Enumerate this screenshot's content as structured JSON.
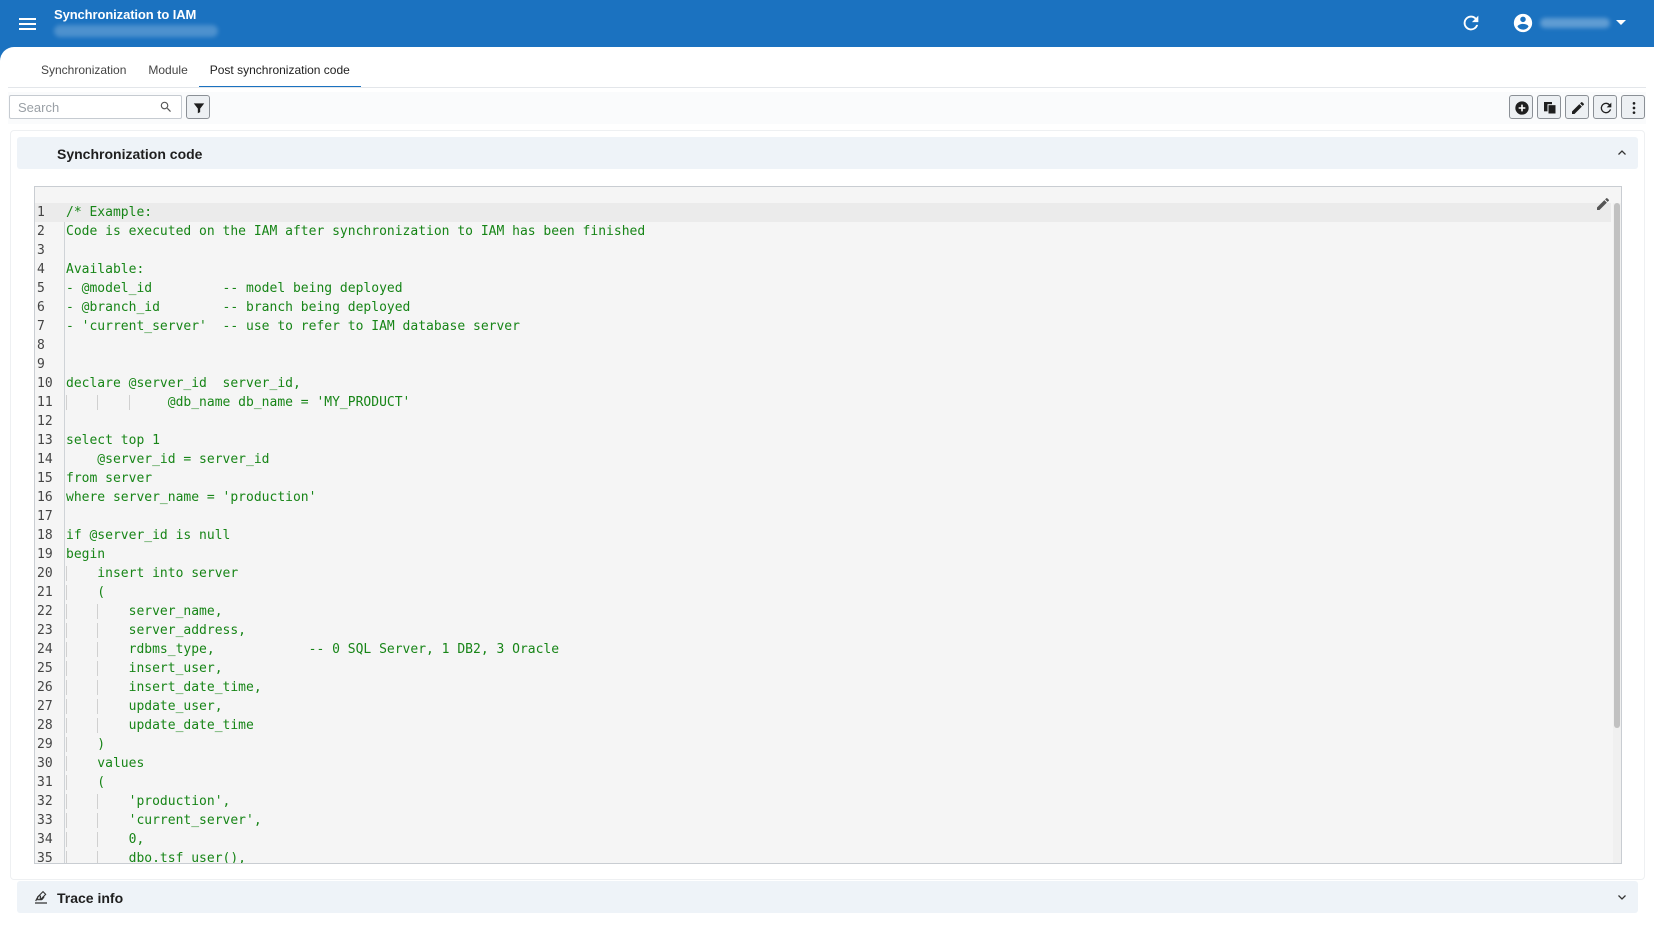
{
  "header": {
    "title": "Synchronization to IAM",
    "menu_icon": "hamburger-menu-icon",
    "refresh_icon": "refresh-icon",
    "account_icon": "account-circle-icon"
  },
  "tabs": [
    {
      "label": "Synchronization"
    },
    {
      "label": "Module"
    },
    {
      "label": "Post synchronization code",
      "active": true
    }
  ],
  "toolbar": {
    "search_placeholder": "Search",
    "right_buttons": [
      "add-icon",
      "copy-icon",
      "edit-icon",
      "refresh-icon",
      "more-icon"
    ]
  },
  "sections": {
    "sync_code": {
      "title": "Synchronization code",
      "expanded": true
    },
    "trace_info": {
      "title": "Trace info",
      "expanded": false
    }
  },
  "editor": {
    "lines": [
      {
        "n": "1",
        "text": "/* Example:",
        "kind": "comment",
        "active": true
      },
      {
        "n": "2",
        "text": "Code is executed on the IAM after synchronization to IAM has been finished",
        "kind": "comment"
      },
      {
        "n": "3",
        "text": "",
        "kind": "comment"
      },
      {
        "n": "4",
        "text": "Available:",
        "kind": "comment"
      },
      {
        "n": "5",
        "text": "- @model_id         -- model being deployed",
        "kind": "comment"
      },
      {
        "n": "6",
        "text": "- @branch_id        -- branch being deployed",
        "kind": "comment"
      },
      {
        "n": "7",
        "text": "- 'current_server'  -- use to refer to IAM database server",
        "kind": "comment"
      },
      {
        "n": "8",
        "text": "",
        "kind": "comment"
      },
      {
        "n": "9",
        "text": "",
        "kind": "comment"
      },
      {
        "n": "10",
        "text": "declare @server_id  server_id,",
        "kind": "comment"
      },
      {
        "n": "11",
        "text": "             @db_name db_name = 'MY_PRODUCT'",
        "kind": "comment",
        "guides": 3
      },
      {
        "n": "12",
        "text": "",
        "kind": "comment"
      },
      {
        "n": "13",
        "text": "select top 1",
        "kind": "comment"
      },
      {
        "n": "14",
        "text": "    @server_id = server_id",
        "kind": "comment"
      },
      {
        "n": "15",
        "text": "from server",
        "kind": "comment"
      },
      {
        "n": "16",
        "text": "where server_name = 'production'",
        "kind": "comment"
      },
      {
        "n": "17",
        "text": "",
        "kind": "comment"
      },
      {
        "n": "18",
        "text": "if @server_id is null",
        "kind": "comment"
      },
      {
        "n": "19",
        "text": "begin",
        "kind": "comment"
      },
      {
        "n": "20",
        "text": "    insert into server",
        "kind": "comment",
        "guides": 1
      },
      {
        "n": "21",
        "text": "    (",
        "kind": "comment",
        "guides": 1
      },
      {
        "n": "22",
        "text": "        server_name,",
        "kind": "comment",
        "guides": 2
      },
      {
        "n": "23",
        "text": "        server_address,",
        "kind": "comment",
        "guides": 2
      },
      {
        "n": "24",
        "text": "        rdbms_type,            -- 0 SQL Server, 1 DB2, 3 Oracle",
        "kind": "comment",
        "guides": 2
      },
      {
        "n": "25",
        "text": "        insert_user,",
        "kind": "comment",
        "guides": 2
      },
      {
        "n": "26",
        "text": "        insert_date_time,",
        "kind": "comment",
        "guides": 2
      },
      {
        "n": "27",
        "text": "        update_user,",
        "kind": "comment",
        "guides": 2
      },
      {
        "n": "28",
        "text": "        update_date_time",
        "kind": "comment",
        "guides": 2
      },
      {
        "n": "29",
        "text": "    )",
        "kind": "comment",
        "guides": 1
      },
      {
        "n": "30",
        "text": "    values",
        "kind": "comment",
        "guides": 1
      },
      {
        "n": "31",
        "text": "    (",
        "kind": "comment",
        "guides": 1
      },
      {
        "n": "32",
        "text": "        'production',",
        "kind": "comment",
        "guides": 2
      },
      {
        "n": "33",
        "text": "        'current_server',",
        "kind": "comment",
        "guides": 2
      },
      {
        "n": "34",
        "text": "        0,",
        "kind": "comment",
        "guides": 2
      },
      {
        "n": "35",
        "text": "        dbo.tsf_user(),",
        "kind": "comment",
        "guides": 2
      }
    ]
  },
  "colors": {
    "appbar": "#1b72c0",
    "comment_text": "#178517",
    "panel_header_bg": "#eef3f8"
  }
}
